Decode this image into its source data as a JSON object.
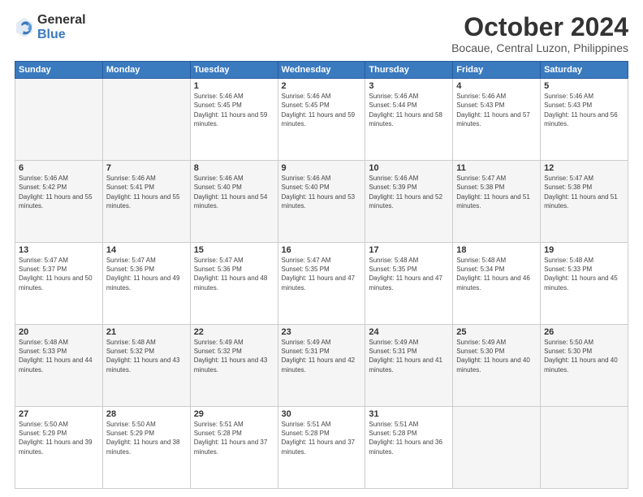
{
  "logo": {
    "general": "General",
    "blue": "Blue"
  },
  "header": {
    "month": "October 2024",
    "location": "Bocaue, Central Luzon, Philippines"
  },
  "weekdays": [
    "Sunday",
    "Monday",
    "Tuesday",
    "Wednesday",
    "Thursday",
    "Friday",
    "Saturday"
  ],
  "weeks": [
    [
      {
        "day": "",
        "info": ""
      },
      {
        "day": "",
        "info": ""
      },
      {
        "day": "1",
        "info": "Sunrise: 5:46 AM\nSunset: 5:45 PM\nDaylight: 11 hours and 59 minutes."
      },
      {
        "day": "2",
        "info": "Sunrise: 5:46 AM\nSunset: 5:45 PM\nDaylight: 11 hours and 59 minutes."
      },
      {
        "day": "3",
        "info": "Sunrise: 5:46 AM\nSunset: 5:44 PM\nDaylight: 11 hours and 58 minutes."
      },
      {
        "day": "4",
        "info": "Sunrise: 5:46 AM\nSunset: 5:43 PM\nDaylight: 11 hours and 57 minutes."
      },
      {
        "day": "5",
        "info": "Sunrise: 5:46 AM\nSunset: 5:43 PM\nDaylight: 11 hours and 56 minutes."
      }
    ],
    [
      {
        "day": "6",
        "info": "Sunrise: 5:46 AM\nSunset: 5:42 PM\nDaylight: 11 hours and 55 minutes."
      },
      {
        "day": "7",
        "info": "Sunrise: 5:46 AM\nSunset: 5:41 PM\nDaylight: 11 hours and 55 minutes."
      },
      {
        "day": "8",
        "info": "Sunrise: 5:46 AM\nSunset: 5:40 PM\nDaylight: 11 hours and 54 minutes."
      },
      {
        "day": "9",
        "info": "Sunrise: 5:46 AM\nSunset: 5:40 PM\nDaylight: 11 hours and 53 minutes."
      },
      {
        "day": "10",
        "info": "Sunrise: 5:46 AM\nSunset: 5:39 PM\nDaylight: 11 hours and 52 minutes."
      },
      {
        "day": "11",
        "info": "Sunrise: 5:47 AM\nSunset: 5:38 PM\nDaylight: 11 hours and 51 minutes."
      },
      {
        "day": "12",
        "info": "Sunrise: 5:47 AM\nSunset: 5:38 PM\nDaylight: 11 hours and 51 minutes."
      }
    ],
    [
      {
        "day": "13",
        "info": "Sunrise: 5:47 AM\nSunset: 5:37 PM\nDaylight: 11 hours and 50 minutes."
      },
      {
        "day": "14",
        "info": "Sunrise: 5:47 AM\nSunset: 5:36 PM\nDaylight: 11 hours and 49 minutes."
      },
      {
        "day": "15",
        "info": "Sunrise: 5:47 AM\nSunset: 5:36 PM\nDaylight: 11 hours and 48 minutes."
      },
      {
        "day": "16",
        "info": "Sunrise: 5:47 AM\nSunset: 5:35 PM\nDaylight: 11 hours and 47 minutes."
      },
      {
        "day": "17",
        "info": "Sunrise: 5:48 AM\nSunset: 5:35 PM\nDaylight: 11 hours and 47 minutes."
      },
      {
        "day": "18",
        "info": "Sunrise: 5:48 AM\nSunset: 5:34 PM\nDaylight: 11 hours and 46 minutes."
      },
      {
        "day": "19",
        "info": "Sunrise: 5:48 AM\nSunset: 5:33 PM\nDaylight: 11 hours and 45 minutes."
      }
    ],
    [
      {
        "day": "20",
        "info": "Sunrise: 5:48 AM\nSunset: 5:33 PM\nDaylight: 11 hours and 44 minutes."
      },
      {
        "day": "21",
        "info": "Sunrise: 5:48 AM\nSunset: 5:32 PM\nDaylight: 11 hours and 43 minutes."
      },
      {
        "day": "22",
        "info": "Sunrise: 5:49 AM\nSunset: 5:32 PM\nDaylight: 11 hours and 43 minutes."
      },
      {
        "day": "23",
        "info": "Sunrise: 5:49 AM\nSunset: 5:31 PM\nDaylight: 11 hours and 42 minutes."
      },
      {
        "day": "24",
        "info": "Sunrise: 5:49 AM\nSunset: 5:31 PM\nDaylight: 11 hours and 41 minutes."
      },
      {
        "day": "25",
        "info": "Sunrise: 5:49 AM\nSunset: 5:30 PM\nDaylight: 11 hours and 40 minutes."
      },
      {
        "day": "26",
        "info": "Sunrise: 5:50 AM\nSunset: 5:30 PM\nDaylight: 11 hours and 40 minutes."
      }
    ],
    [
      {
        "day": "27",
        "info": "Sunrise: 5:50 AM\nSunset: 5:29 PM\nDaylight: 11 hours and 39 minutes."
      },
      {
        "day": "28",
        "info": "Sunrise: 5:50 AM\nSunset: 5:29 PM\nDaylight: 11 hours and 38 minutes."
      },
      {
        "day": "29",
        "info": "Sunrise: 5:51 AM\nSunset: 5:28 PM\nDaylight: 11 hours and 37 minutes."
      },
      {
        "day": "30",
        "info": "Sunrise: 5:51 AM\nSunset: 5:28 PM\nDaylight: 11 hours and 37 minutes."
      },
      {
        "day": "31",
        "info": "Sunrise: 5:51 AM\nSunset: 5:28 PM\nDaylight: 11 hours and 36 minutes."
      },
      {
        "day": "",
        "info": ""
      },
      {
        "day": "",
        "info": ""
      }
    ]
  ]
}
